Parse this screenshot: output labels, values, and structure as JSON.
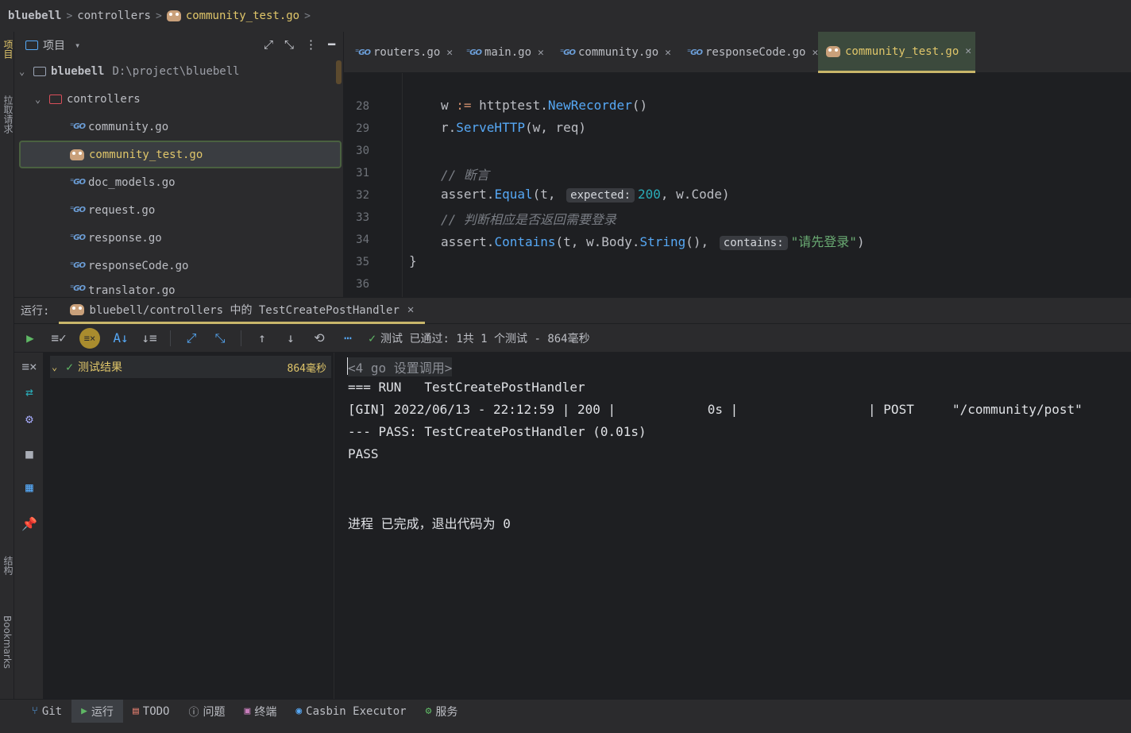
{
  "breadcrumb": {
    "items": [
      "bluebell",
      "controllers",
      "community_test.go"
    ]
  },
  "left_stripe": {
    "project_label": "项目",
    "pull_requests_label": "拉取请求",
    "structure_label": "结构",
    "bookmarks_label": "Bookmarks"
  },
  "project_panel": {
    "title": "项目",
    "root_name": "bluebell",
    "root_path": "D:\\project\\bluebell",
    "folder": "controllers",
    "files": [
      "community.go",
      "community_test.go",
      "doc_models.go",
      "request.go",
      "response.go",
      "responseCode.go",
      "translator.go"
    ]
  },
  "editor": {
    "tabs": [
      "routers.go",
      "main.go",
      "community.go",
      "responseCode.go",
      "community_test.go"
    ],
    "active_tab": "community_test.go",
    "line_numbers": [
      "28",
      "29",
      "30",
      "31",
      "32",
      "33",
      "34",
      "35",
      "36"
    ],
    "hint_expected": "expected:",
    "hint_contains": "contains:",
    "comment_assert": "// 断言",
    "comment_check": "// 判断相应是否返回需要登录",
    "string_login": "\"请先登录\""
  },
  "run": {
    "label": "运行:",
    "tab_title": "bluebell/controllers 中的 TestCreatePostHandler",
    "status": "测试 已通过: 1共 1 个测试 - 864毫秒",
    "test_results_label": "测试结果",
    "test_results_time": "864毫秒"
  },
  "console": {
    "lines": [
      "<4 go 设置调用>",
      "=== RUN   TestCreatePostHandler",
      "[GIN] 2022/06/13 - 22:12:59 | 200 |            0s |                 | POST     \"/community/post\"",
      "--- PASS: TestCreatePostHandler (0.01s)",
      "PASS",
      "",
      "",
      "进程 已完成，退出代码为 0"
    ]
  },
  "bottom_bar": {
    "items": [
      "Git",
      "运行",
      "TODO",
      "问题",
      "终端",
      "Casbin Executor",
      "服务"
    ],
    "active": "运行"
  },
  "colors": {
    "accent_yellow": "#c9b66a",
    "success_green": "#5fb865",
    "background": "#1e1f22",
    "panel": "#2b2b2d"
  }
}
